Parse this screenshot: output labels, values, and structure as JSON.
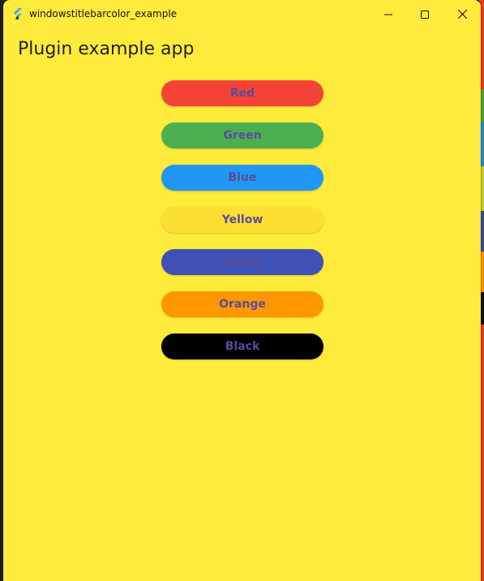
{
  "window": {
    "title": "windowstitlebarcolor_example",
    "background": "#ffeb3b"
  },
  "app": {
    "heading": "Plugin example app"
  },
  "buttons": [
    {
      "label": "Red",
      "color": "#f44336"
    },
    {
      "label": "Green",
      "color": "#4caf50"
    },
    {
      "label": "Blue",
      "color": "#2196f3"
    },
    {
      "label": "Yellow",
      "color": "#fbe032"
    },
    {
      "label": "Indigo",
      "color": "#3f51b5"
    },
    {
      "label": "Orange",
      "color": "#ff9800"
    },
    {
      "label": "Black",
      "color": "#000000"
    }
  ],
  "icons": {
    "app": "flutter-logo-icon",
    "minimize": "minimize-icon",
    "maximize": "maximize-icon",
    "close": "close-icon"
  },
  "label_color": "#5b4a9e"
}
